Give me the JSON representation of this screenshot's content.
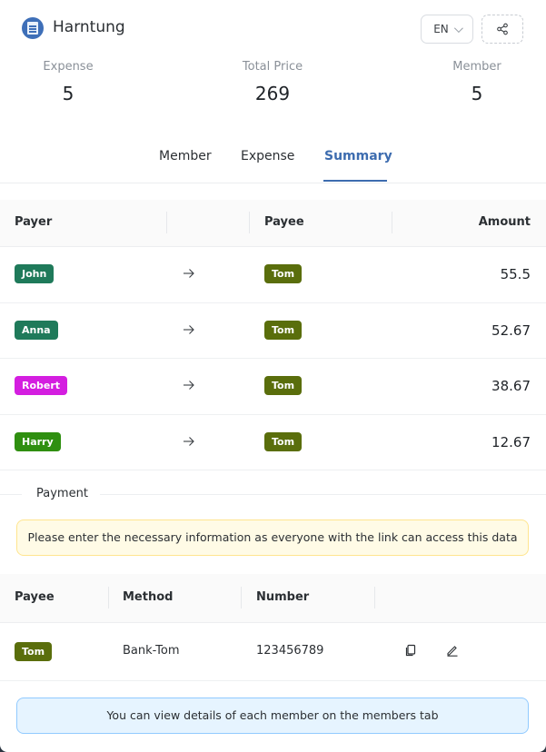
{
  "header": {
    "app_name": "Harntung",
    "language": "EN",
    "logo_icon": "notebook-icon",
    "share_icon": "share-icon"
  },
  "stats": [
    {
      "label": "Expense",
      "value": "5"
    },
    {
      "label": "Total Price",
      "value": "269"
    },
    {
      "label": "Member",
      "value": "5"
    }
  ],
  "tabs": [
    {
      "label": "Member",
      "active": false
    },
    {
      "label": "Expense",
      "active": false
    },
    {
      "label": "Summary",
      "active": true
    }
  ],
  "summary": {
    "columns": {
      "payer": "Payer",
      "payee": "Payee",
      "amount": "Amount"
    },
    "rows": [
      {
        "payer": "John",
        "payer_color": "#1f7a5a",
        "payee": "Tom",
        "payee_color": "#5a6e0c",
        "amount": "55.5"
      },
      {
        "payer": "Anna",
        "payer_color": "#1f7a5a",
        "payee": "Tom",
        "payee_color": "#5a6e0c",
        "amount": "52.67"
      },
      {
        "payer": "Robert",
        "payer_color": "#d41ee0",
        "payee": "Tom",
        "payee_color": "#5a6e0c",
        "amount": "38.67"
      },
      {
        "payer": "Harry",
        "payer_color": "#2f8f10",
        "payee": "Tom",
        "payee_color": "#5a6e0c",
        "amount": "12.67"
      }
    ]
  },
  "payment": {
    "section_label": "Payment",
    "warning": "Please enter the necessary information as everyone with the link can access this data",
    "columns": {
      "payee": "Payee",
      "method": "Method",
      "number": "Number"
    },
    "rows": [
      {
        "payee": "Tom",
        "payee_color": "#5a6e0c",
        "method": "Bank-Tom",
        "number": "123456789"
      }
    ]
  },
  "info": "You can view details of each member on the members tab"
}
